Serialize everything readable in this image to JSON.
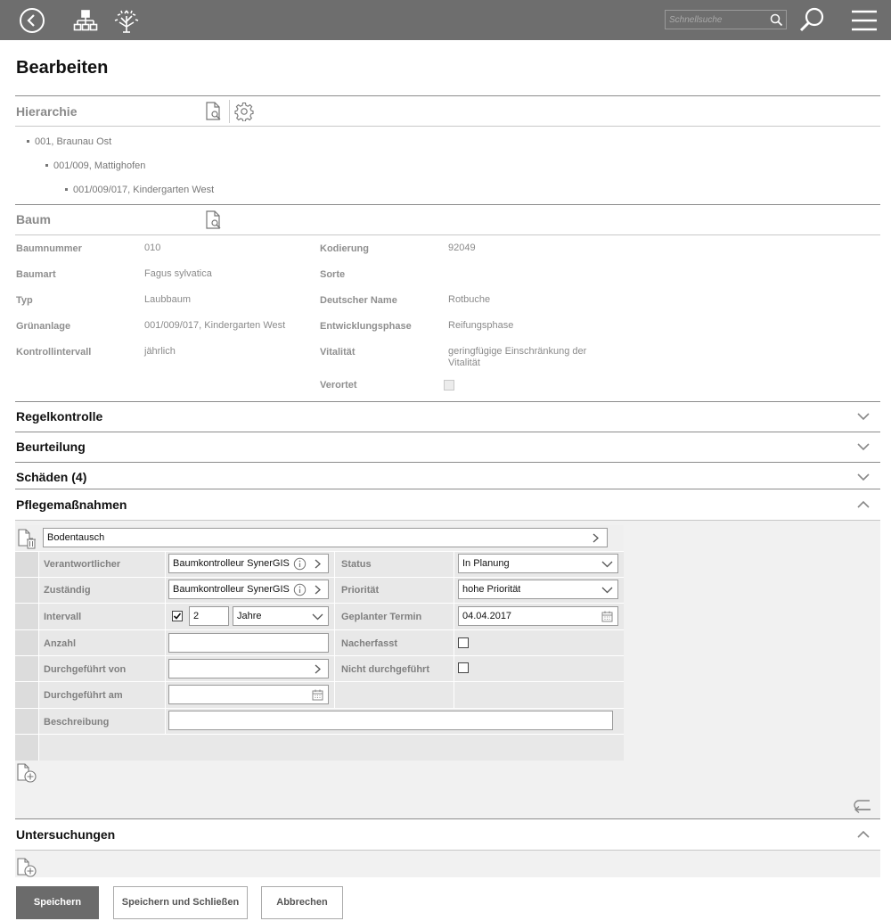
{
  "topbar": {
    "back_icon": "back-circle-icon",
    "hierarchy_icon": "hierarchy-icon",
    "tree_icon": "tree-icon",
    "quick_search_placeholder": "Schnellsuche",
    "search_icon": "magnifier-icon",
    "menu_icon": "hamburger-menu-icon"
  },
  "page": {
    "title": "Bearbeiten"
  },
  "hierarchy": {
    "title": "Hierarchie",
    "items": [
      "001, Braunau Ost",
      "001/009, Mattighofen",
      "001/009/017, Kindergarten West"
    ]
  },
  "tree": {
    "title": "Baum",
    "left": [
      {
        "label": "Baumnummer",
        "value": "010"
      },
      {
        "label": "Baumart",
        "value": "Fagus sylvatica"
      },
      {
        "label": "Typ",
        "value": "Laubbaum"
      },
      {
        "label": "Grünanlage",
        "value": "001/009/017, Kindergarten West"
      },
      {
        "label": "Kontrollintervall",
        "value": "jährlich"
      }
    ],
    "right": [
      {
        "label": "Kodierung",
        "value": "92049"
      },
      {
        "label": "Sorte",
        "value": ""
      },
      {
        "label": "Deutscher Name",
        "value": "Rotbuche"
      },
      {
        "label": "Entwicklungsphase",
        "value": "Reifungsphase"
      },
      {
        "label": "Vitalität",
        "value": "geringfügige Einschränkung der Vitalität"
      }
    ],
    "located_label": "Verortet",
    "located_checked": false
  },
  "sections": {
    "regelkontrolle": "Regelkontrolle",
    "beurteilung": "Beurteilung",
    "schaeden": "Schäden (4)",
    "pflege": "Pflegemaßnahmen",
    "untersuchungen": "Untersuchungen"
  },
  "pflege": {
    "measure": "Bodentausch",
    "verantwortlicher_label": "Verantwortlicher",
    "verantwortlicher_value": "Baumkontrolleur SynerGIS",
    "zustaendig_label": "Zuständig",
    "zustaendig_value": "Baumkontrolleur SynerGIS",
    "intervall_label": "Intervall",
    "intervall_checked": true,
    "intervall_number": "2",
    "intervall_unit": "Jahre",
    "anzahl_label": "Anzahl",
    "anzahl_value": "",
    "durchgefuehrt_von_label": "Durchgeführt von",
    "durchgefuehrt_von_value": "",
    "durchgefuehrt_am_label": "Durchgeführt am",
    "durchgefuehrt_am_value": "",
    "beschreibung_label": "Beschreibung",
    "beschreibung_value": "",
    "status_label": "Status",
    "status_value": "In Planung",
    "prioritaet_label": "Priorität",
    "prioritaet_value": "hohe Priorität",
    "termin_label": "Geplanter Termin",
    "termin_value": "04.04.2017",
    "nacherfasst_label": "Nacherfasst",
    "nacherfasst_checked": false,
    "nicht_durchgefuehrt_label": "Nicht durchgeführt",
    "nicht_durchgefuehrt_checked": false
  },
  "buttons": {
    "save": "Speichern",
    "save_close": "Speichern und Schließen",
    "cancel": "Abbrechen"
  },
  "colors": {
    "topbar": "#6e6e6e",
    "primary_button": "#6b6b6b"
  }
}
